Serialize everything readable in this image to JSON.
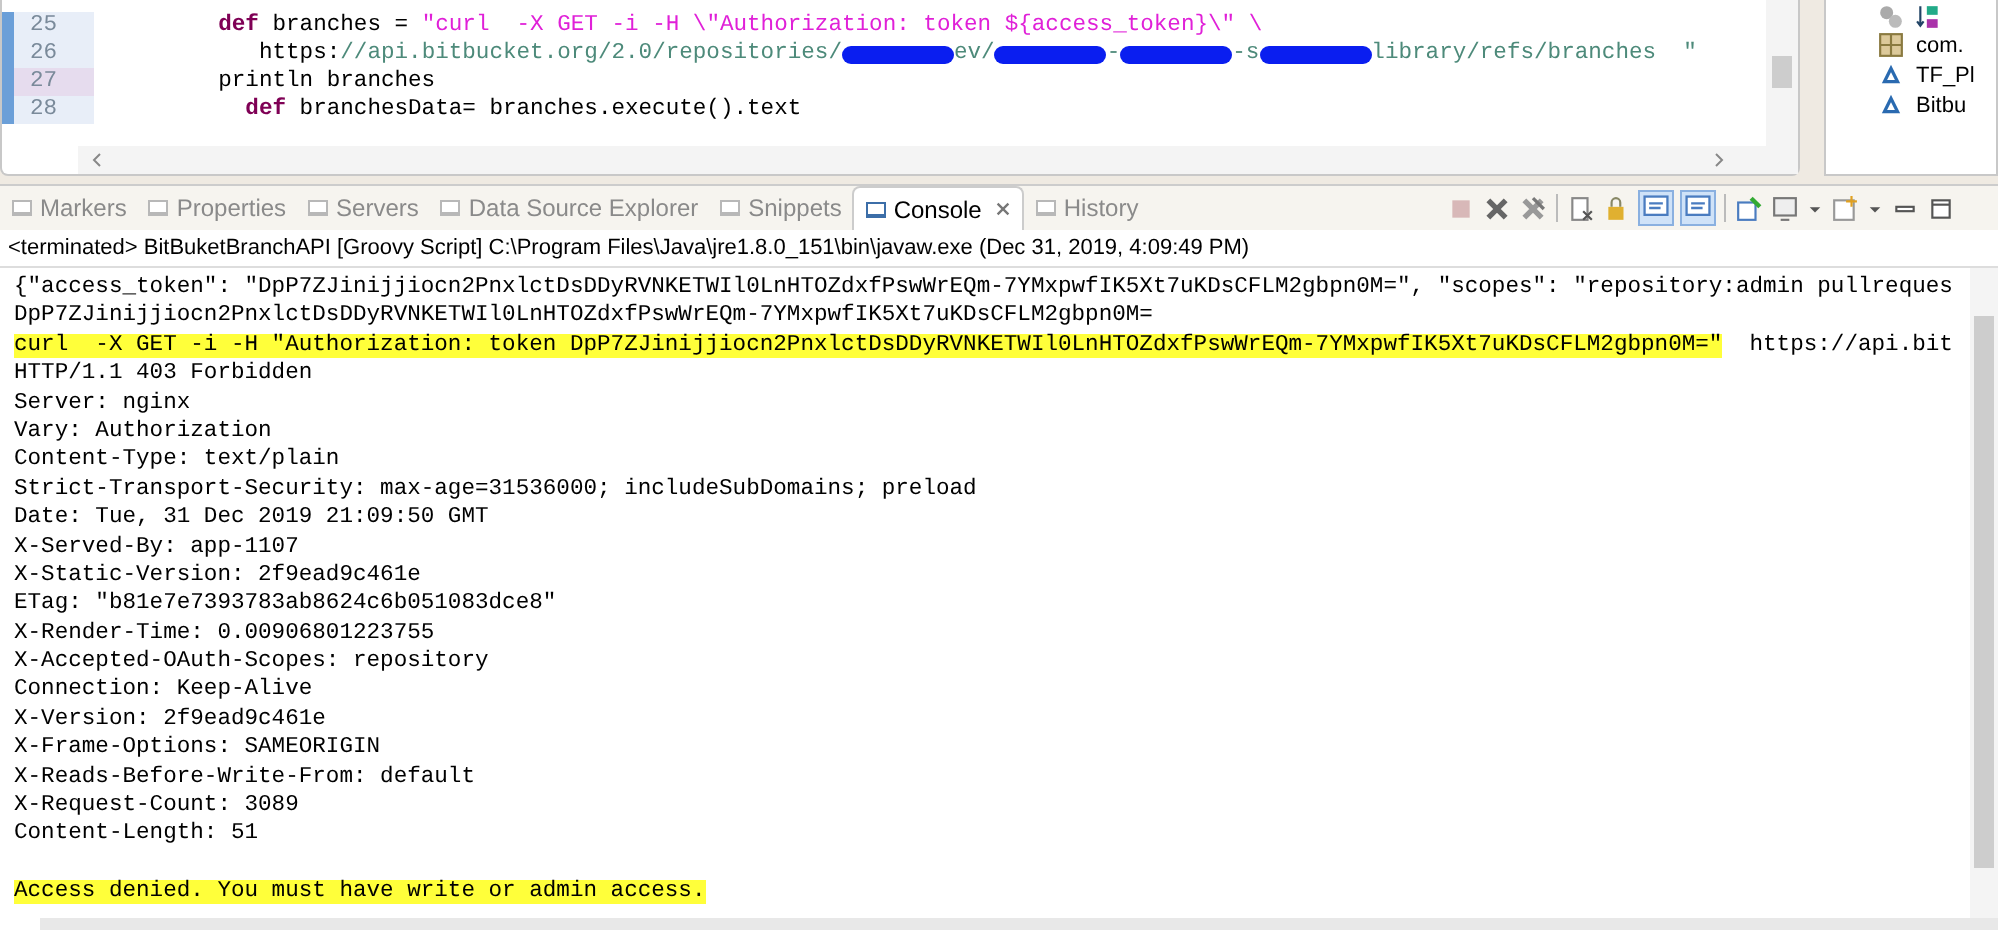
{
  "editor": {
    "lines": [
      {
        "number": "25",
        "current": false,
        "segments": [
          {
            "kind": "keyword",
            "text": "    def"
          },
          {
            "kind": "plain",
            "text": " branches = "
          },
          {
            "kind": "string",
            "text": "\"curl  -X GET -i -H \\\"Authorization: token ${access_token}\\\" \\"
          }
        ]
      },
      {
        "number": "26",
        "current": false,
        "segments": [
          {
            "kind": "plain",
            "text": "       https:"
          },
          {
            "kind": "url",
            "text": "//api.bitbucket.org/2.0/repositories/"
          },
          {
            "kind": "redaction"
          },
          {
            "kind": "url",
            "text": "ev/"
          },
          {
            "kind": "redaction"
          },
          {
            "kind": "url",
            "text": "-"
          },
          {
            "kind": "redaction"
          },
          {
            "kind": "url",
            "text": "-s"
          },
          {
            "kind": "redaction"
          },
          {
            "kind": "url",
            "text": "library/refs/branches  \""
          }
        ]
      },
      {
        "number": "27",
        "current": true,
        "segments": [
          {
            "kind": "plain",
            "text": "    println branches"
          }
        ]
      },
      {
        "number": "28",
        "current": false,
        "segments": [
          {
            "kind": "keyword",
            "text": "      def"
          },
          {
            "kind": "plain",
            "text": " branchesData= branches.execute().text"
          }
        ]
      }
    ]
  },
  "outline": {
    "items": [
      {
        "label": "com.",
        "kind": "package"
      },
      {
        "label": "TF_Pl",
        "kind": "field"
      },
      {
        "label": "Bitbu",
        "kind": "field"
      }
    ]
  },
  "console": {
    "tabs": [
      {
        "label": "Markers",
        "selected": false
      },
      {
        "label": "Properties",
        "selected": false
      },
      {
        "label": "Servers",
        "selected": false
      },
      {
        "label": "Data Source Explorer",
        "selected": false
      },
      {
        "label": "Snippets",
        "selected": false
      },
      {
        "label": "Console",
        "selected": true
      },
      {
        "label": "History",
        "selected": false
      }
    ],
    "toggles": [
      {
        "selected": true
      },
      {
        "selected": true
      }
    ],
    "header": "<terminated> BitBuketBranchAPI [Groovy Script] C:\\Program Files\\Java\\jre1.8.0_151\\bin\\javaw.exe (Dec 31, 2019, 4:09:49 PM)",
    "lines": [
      {
        "segments": [
          {
            "text": "{\"access_token\": \"DpP7ZJinijjiocn2PnxlctDsDDyRVNKETWIl0LnHTOZdxfPswWrEQm-7YMxpwfIK5Xt7uKDsCFLM2gbpn0M=\", \"scopes\": \"repository:admin pullreques",
            "highlighted": false
          }
        ]
      },
      {
        "segments": [
          {
            "text": "DpP7ZJinijjiocn2PnxlctDsDDyRVNKETWIl0LnHTOZdxfPswWrEQm-7YMxpwfIK5Xt7uKDsCFLM2gbpn0M=",
            "highlighted": false
          }
        ]
      },
      {
        "segments": [
          {
            "text": "curl  -X GET -i -H \"Authorization: token DpP7ZJinijjiocn2PnxlctDsDDyRVNKETWIl0LnHTOZdxfPswWrEQm-7YMxpwfIK5Xt7uKDsCFLM2gbpn0M=\"",
            "highlighted": true
          },
          {
            "text": "  https://api.bit",
            "highlighted": false
          }
        ]
      },
      {
        "segments": [
          {
            "text": "HTTP/1.1 403 Forbidden",
            "highlighted": false
          }
        ]
      },
      {
        "segments": [
          {
            "text": "Server: nginx",
            "highlighted": false
          }
        ]
      },
      {
        "segments": [
          {
            "text": "Vary: Authorization",
            "highlighted": false
          }
        ]
      },
      {
        "segments": [
          {
            "text": "Content-Type: text/plain",
            "highlighted": false
          }
        ]
      },
      {
        "segments": [
          {
            "text": "Strict-Transport-Security: max-age=31536000; includeSubDomains; preload",
            "highlighted": false
          }
        ]
      },
      {
        "segments": [
          {
            "text": "Date: Tue, 31 Dec 2019 21:09:50 GMT",
            "highlighted": false
          }
        ]
      },
      {
        "segments": [
          {
            "text": "X-Served-By: app-1107",
            "highlighted": false
          }
        ]
      },
      {
        "segments": [
          {
            "text": "X-Static-Version: 2f9ead9c461e",
            "highlighted": false
          }
        ]
      },
      {
        "segments": [
          {
            "text": "ETag: \"b81e7e7393783ab8624c6b051083dce8\"",
            "highlighted": false
          }
        ]
      },
      {
        "segments": [
          {
            "text": "X-Render-Time: 0.00906801223755",
            "highlighted": false
          }
        ]
      },
      {
        "segments": [
          {
            "text": "X-Accepted-OAuth-Scopes: repository",
            "highlighted": false
          }
        ]
      },
      {
        "segments": [
          {
            "text": "Connection: Keep-Alive",
            "highlighted": false
          }
        ]
      },
      {
        "segments": [
          {
            "text": "X-Version: 2f9ead9c461e",
            "highlighted": false
          }
        ]
      },
      {
        "segments": [
          {
            "text": "X-Frame-Options: SAMEORIGIN",
            "highlighted": false
          }
        ]
      },
      {
        "segments": [
          {
            "text": "X-Reads-Before-Write-From: default",
            "highlighted": false
          }
        ]
      },
      {
        "segments": [
          {
            "text": "X-Request-Count: 3089",
            "highlighted": false
          }
        ]
      },
      {
        "segments": [
          {
            "text": "Content-Length: 51",
            "highlighted": false
          }
        ]
      },
      {
        "blank_before": true,
        "segments": [
          {
            "text": "Access denied. You must have write or admin access.",
            "highlighted": true
          }
        ]
      }
    ]
  }
}
